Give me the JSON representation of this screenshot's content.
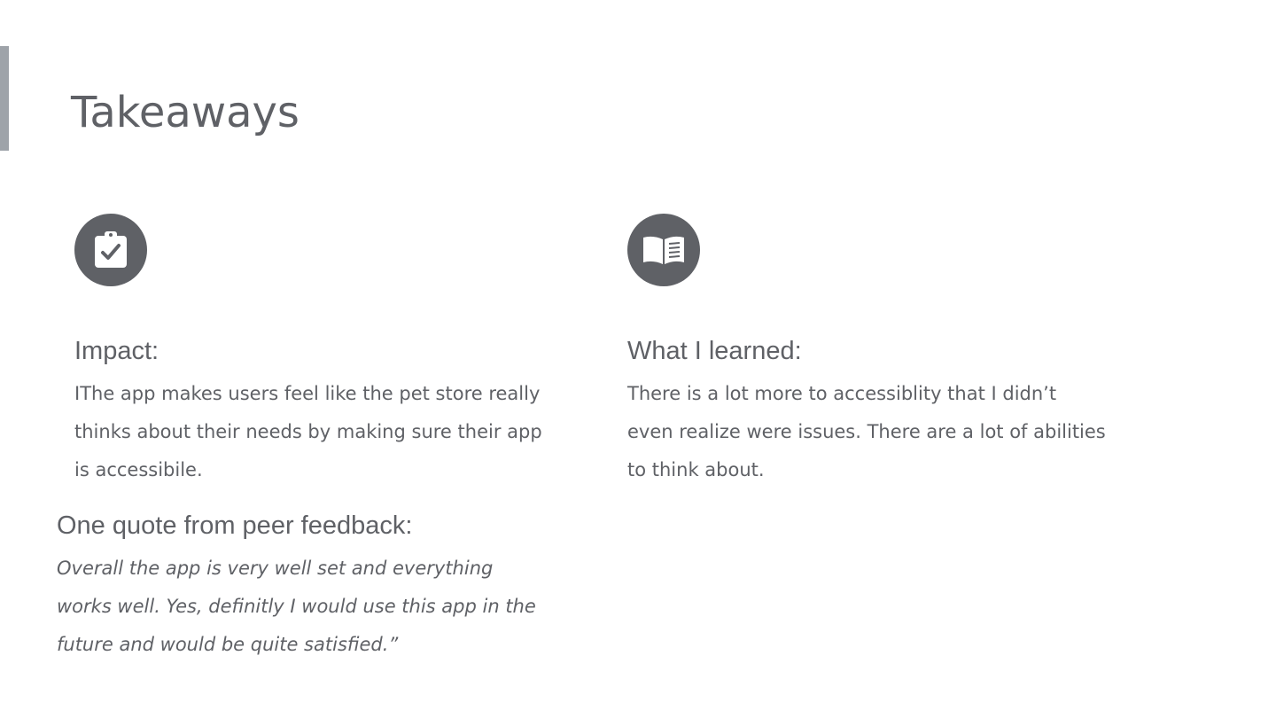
{
  "slide": {
    "title": "Takeaways"
  },
  "impact": {
    "icon": "clipboard-check-icon",
    "heading": "Impact:",
    "body": "IThe app makes users feel like the pet store really thinks about their needs by making sure their app is accessibile."
  },
  "learned": {
    "icon": "open-book-icon",
    "heading": "What I learned:",
    "body": "There is a lot more to accessiblity that I didn’t even realize were issues. There are a lot of abilities to think about."
  },
  "quote": {
    "heading": "One quote from peer feedback:",
    "body": "Overall the app is very well set and everything works well. Yes, definitly I would use this app in the future and would be quite satisfied.”"
  },
  "colors": {
    "text": "#5f6166",
    "accent_bar": "#9ea3a9",
    "icon_circle": "#5f6166",
    "background": "#ffffff"
  }
}
